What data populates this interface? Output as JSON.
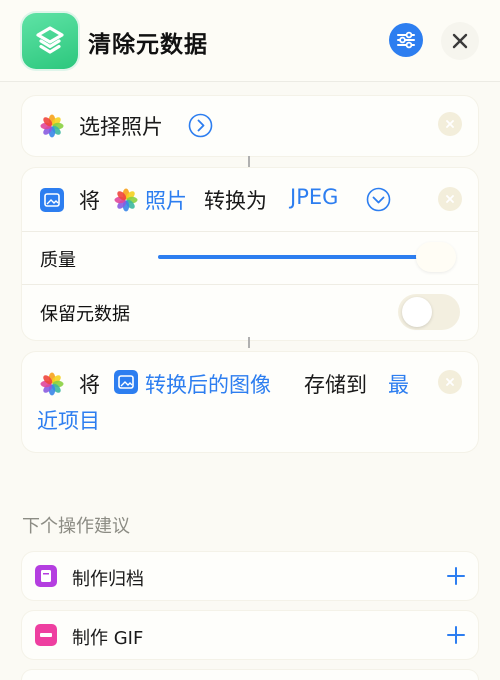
{
  "header": {
    "title": "清除元数据"
  },
  "actions": {
    "select_photos": {
      "label": "选择照片"
    },
    "convert": {
      "prefix": "将",
      "input": "照片",
      "verb": "转换为",
      "format": "JPEG",
      "quality_label": "质量",
      "quality_value": 1.0,
      "keep_metadata_label": "保留元数据",
      "keep_metadata_on": false
    },
    "save": {
      "prefix": "将",
      "input": "转换后的图像",
      "verb": "存储到",
      "destination_line1": "最",
      "destination_line2": "近项目"
    }
  },
  "suggestions": {
    "heading": "下个操作建议",
    "items": [
      {
        "label": "制作归档",
        "icon": "archive-icon",
        "color": "#b43ee0"
      },
      {
        "label": "制作 GIF",
        "icon": "gif-icon",
        "color": "#ee3fa0"
      }
    ]
  },
  "colors": {
    "accent": "#2d7ef0",
    "app_icon": "#3ccf8c"
  }
}
